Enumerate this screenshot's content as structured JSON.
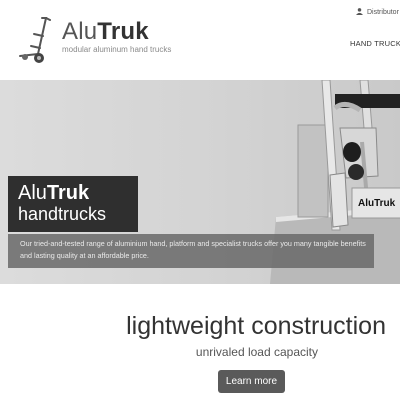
{
  "header": {
    "brand_light": "Alu",
    "brand_bold": "Truk",
    "tagline": "modular aluminum hand trucks",
    "distributor_label": "Distributor",
    "nav_item": "HAND TRUCKS"
  },
  "hero": {
    "title_light": "Alu",
    "title_bold": "Truk",
    "title_line2": "handtrucks",
    "caption": "Our tried-and-tested range of aluminium hand, platform and specialist trucks offer you many tangible benefits and lasting quality at an affordable price.",
    "product_label": "AluTruk"
  },
  "main": {
    "headline": "lightweight construction",
    "subline": "unrivaled load capacity",
    "cta_label": "Learn more"
  },
  "icons": {
    "logo": "hand-truck-logo-icon",
    "user": "user-icon"
  }
}
